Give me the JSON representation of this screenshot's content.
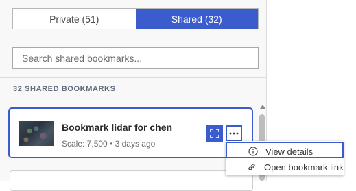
{
  "tabs": {
    "private_label": "Private (51)",
    "shared_label": "Shared (32)",
    "active": "shared"
  },
  "search": {
    "placeholder": "Search shared bookmarks...",
    "value": ""
  },
  "section": {
    "title": "32 SHARED BOOKMARKS"
  },
  "bookmarks": [
    {
      "title": "Bookmark lidar for chen",
      "meta": "Scale: 7,500 • 3 days ago",
      "thumbnail": "lidar-point-cloud-thumbnail"
    }
  ],
  "actions": {
    "zoom_icon": "zoom-to-icon",
    "more_icon": "more-options-icon"
  },
  "menu": {
    "items": [
      {
        "label": "View details",
        "icon": "info-icon"
      },
      {
        "label": "Open bookmark link",
        "icon": "link-icon"
      }
    ]
  },
  "colors": {
    "accent": "#3b5ccc",
    "panel_bg": "#f8f8f8",
    "text": "#323232",
    "muted": "#6b6b6b"
  }
}
